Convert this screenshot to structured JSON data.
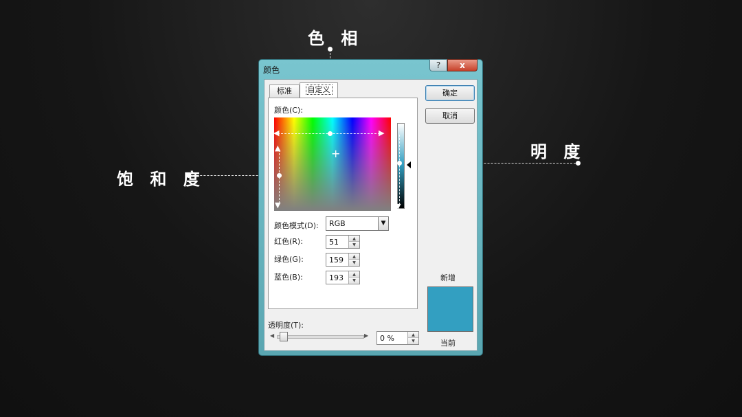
{
  "annotations": {
    "hue": "色 相",
    "saturation": "饱 和 度",
    "brightness": "明 度"
  },
  "dialog": {
    "title": "颜色",
    "help_label": "?",
    "close_label": "x",
    "tabs": [
      {
        "label": "标准",
        "active": false
      },
      {
        "label": "自定义",
        "active": true
      }
    ],
    "color_label": "颜色(C):",
    "color_mode_label": "颜色模式(D):",
    "color_mode_value": "RGB",
    "fields": [
      {
        "label": "红色(R):",
        "value": "51"
      },
      {
        "label": "绿色(G):",
        "value": "159"
      },
      {
        "label": "蓝色(B):",
        "value": "193"
      }
    ],
    "transparency_label": "透明度(T):",
    "transparency_value": "0 %",
    "ok_label": "确定",
    "cancel_label": "取消",
    "new_label": "新增",
    "current_label": "当前",
    "selected_color": "#339fc1"
  },
  "icons": {
    "combo": "chevron-down-icon",
    "spin_up": "caret-up-icon",
    "spin_down": "caret-down-icon"
  }
}
